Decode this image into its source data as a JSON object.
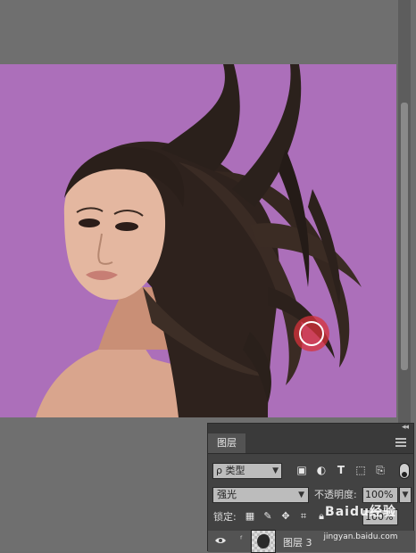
{
  "panel": {
    "tab": "图层",
    "filter_label": "ρ 类型",
    "blend_mode": "强光",
    "opacity_label": "不透明度:",
    "opacity_value": "100%",
    "lock_label": "锁定:",
    "fill_value": "100%",
    "layer_name": "图层 3"
  },
  "watermark": {
    "logo": "Baidu经验",
    "url": "jingyan.baidu.com"
  },
  "colors": {
    "canvas_background": "#ac6fba",
    "brush_cursor": "#d7323a"
  },
  "icons": [
    "collapse-icon",
    "panel-menu-icon",
    "image-filter-icon",
    "adjustment-filter-icon",
    "type-filter-icon",
    "shape-filter-icon",
    "smart-object-filter-icon",
    "lock-transparent-icon",
    "lock-paint-icon",
    "lock-position-icon",
    "lock-artboard-icon",
    "lock-all-icon",
    "eye-icon",
    "link-icon"
  ]
}
